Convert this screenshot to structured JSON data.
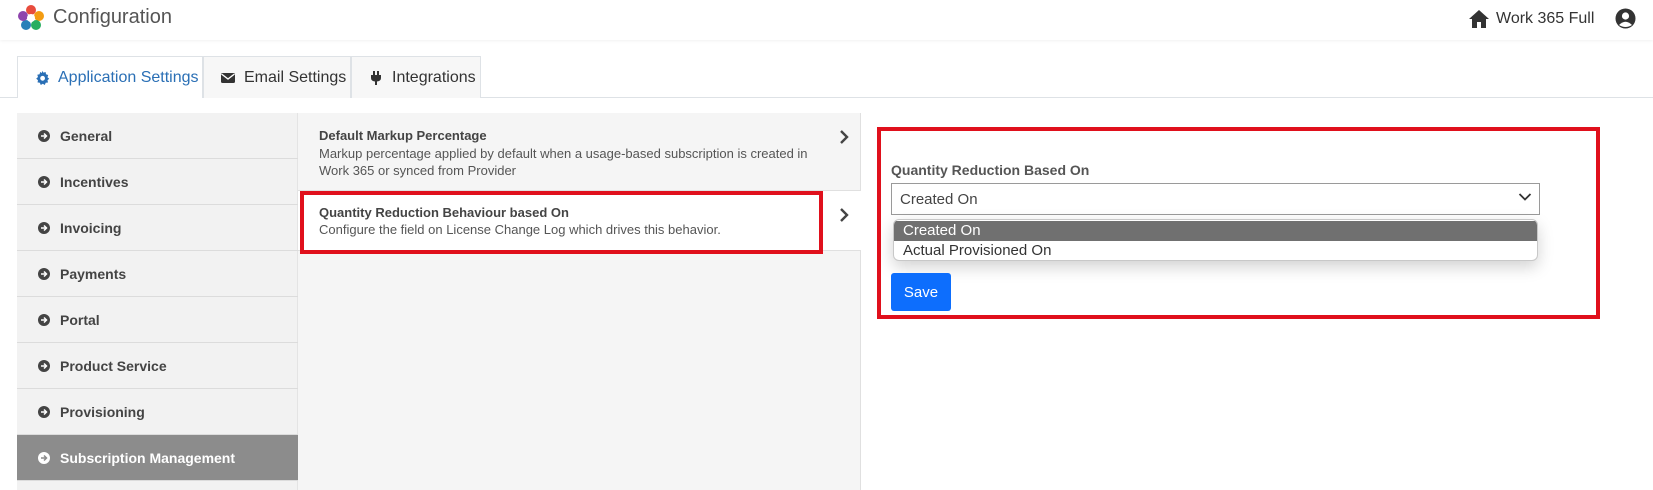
{
  "header": {
    "title": "Configuration",
    "org_name": "Work 365 Full",
    "brand_color": "#2a6fb5"
  },
  "tabs": [
    {
      "label": "Application Settings",
      "icon": "gear-icon",
      "active": true
    },
    {
      "label": "Email Settings",
      "icon": "envelope-icon",
      "active": false
    },
    {
      "label": "Integrations",
      "icon": "plug-icon",
      "active": false
    }
  ],
  "sidebar": {
    "items": [
      {
        "label": "General",
        "active": false
      },
      {
        "label": "Incentives",
        "active": false
      },
      {
        "label": "Invoicing",
        "active": false
      },
      {
        "label": "Payments",
        "active": false
      },
      {
        "label": "Portal",
        "active": false
      },
      {
        "label": "Product Service",
        "active": false
      },
      {
        "label": "Provisioning",
        "active": false
      },
      {
        "label": "Subscription Management",
        "active": true
      }
    ]
  },
  "settings_list": [
    {
      "title": "Default Markup Percentage",
      "description": "Markup percentage applied by default when a usage-based subscription is created in Work 365 or synced from Provider",
      "active": false
    },
    {
      "title": "Quantity Reduction Behaviour based On",
      "description": "Configure the field on License Change Log which drives this behavior.",
      "active": true
    }
  ],
  "detail": {
    "field_label": "Quantity Reduction Based On",
    "selected_value": "Created On",
    "options": [
      "Created On",
      "Actual Provisioned On"
    ],
    "save_label": "Save"
  },
  "highlight_color": "#e0101c"
}
